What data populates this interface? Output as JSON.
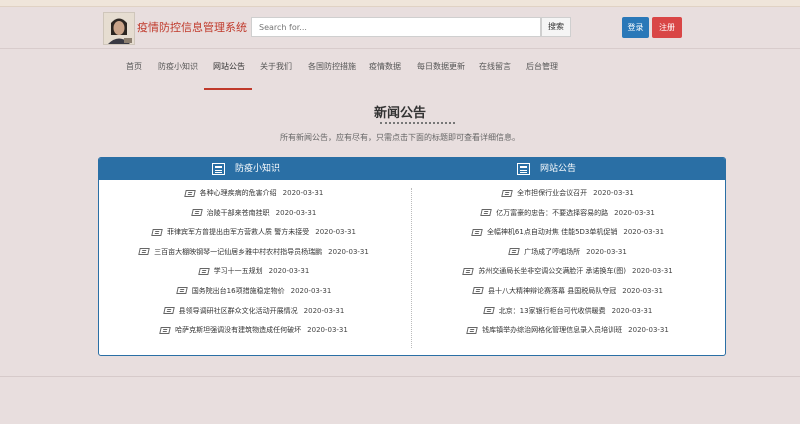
{
  "header": {
    "site_title": "疫情防控信息管理系统",
    "search_placeholder": "Search for...",
    "search_button": "搜索",
    "login_button": "登录",
    "register_button": "注册"
  },
  "nav": {
    "active": "网站公告",
    "items": [
      "首页",
      "防疫小知识",
      "网站公告",
      "关于我们",
      "各国防控措施",
      "疫情数据",
      "每日数据更新",
      "在线留言",
      "后台管理"
    ]
  },
  "page": {
    "title": "新闻公告",
    "subtitle": "所有新闻公告，应有尽有，只需点击下面的标题即可查看详细信息。"
  },
  "panels": {
    "left": {
      "heading": "防疫小知识",
      "items": [
        {
          "title": "各种心理疾病的危害介绍",
          "date": "2020-03-31"
        },
        {
          "title": "治陵干部来苍南挂职",
          "date": "2020-03-31"
        },
        {
          "title": "菲律宾军方曾提出由军方营救人质 警方未接受",
          "date": "2020-03-31"
        },
        {
          "title": "三百亩大棚映钢琴一记仙居乡雅中村农村指导员杨瑞鹏",
          "date": "2020-03-31"
        },
        {
          "title": "学习十一五规划",
          "date": "2020-03-31"
        },
        {
          "title": "国务院出台16项措施稳定物价",
          "date": "2020-03-31"
        },
        {
          "title": "县领导调研社区群众文化活动开展情况",
          "date": "2020-03-31"
        },
        {
          "title": "哈萨克斯坦强调没有建筑物造成任何破坏",
          "date": "2020-03-31"
        }
      ]
    },
    "right": {
      "heading": "网站公告",
      "items": [
        {
          "title": "全市担保行业会议召开",
          "date": "2020-03-31"
        },
        {
          "title": "亿万富豪的忠告：不要选择容易的路",
          "date": "2020-03-31"
        },
        {
          "title": "全幅神机61点自动对焦 佳能5D3单机促销",
          "date": "2020-03-31"
        },
        {
          "title": "广场成了哼唱场所",
          "date": "2020-03-31"
        },
        {
          "title": "苏州交通局长坐非空调公交满脸汗 承诺换车(图)",
          "date": "2020-03-31"
        },
        {
          "title": "县十八大精神辩论赛落幕 县国税局队夺冠",
          "date": "2020-03-31"
        },
        {
          "title": "北京：13家银行柜台可代收供暖费",
          "date": "2020-03-31"
        },
        {
          "title": "钱库镇举办综治网格化管理信息录入员培训班",
          "date": "2020-03-31"
        }
      ]
    }
  },
  "colors": {
    "background": "#e8dede",
    "accent_blue": "#2a6fa5",
    "login_blue": "#2a78b8",
    "register_red": "#d94646",
    "title_red": "#c0392b"
  },
  "icons": {
    "news_heading": "newspaper-icon",
    "row": "newspaper-icon"
  }
}
